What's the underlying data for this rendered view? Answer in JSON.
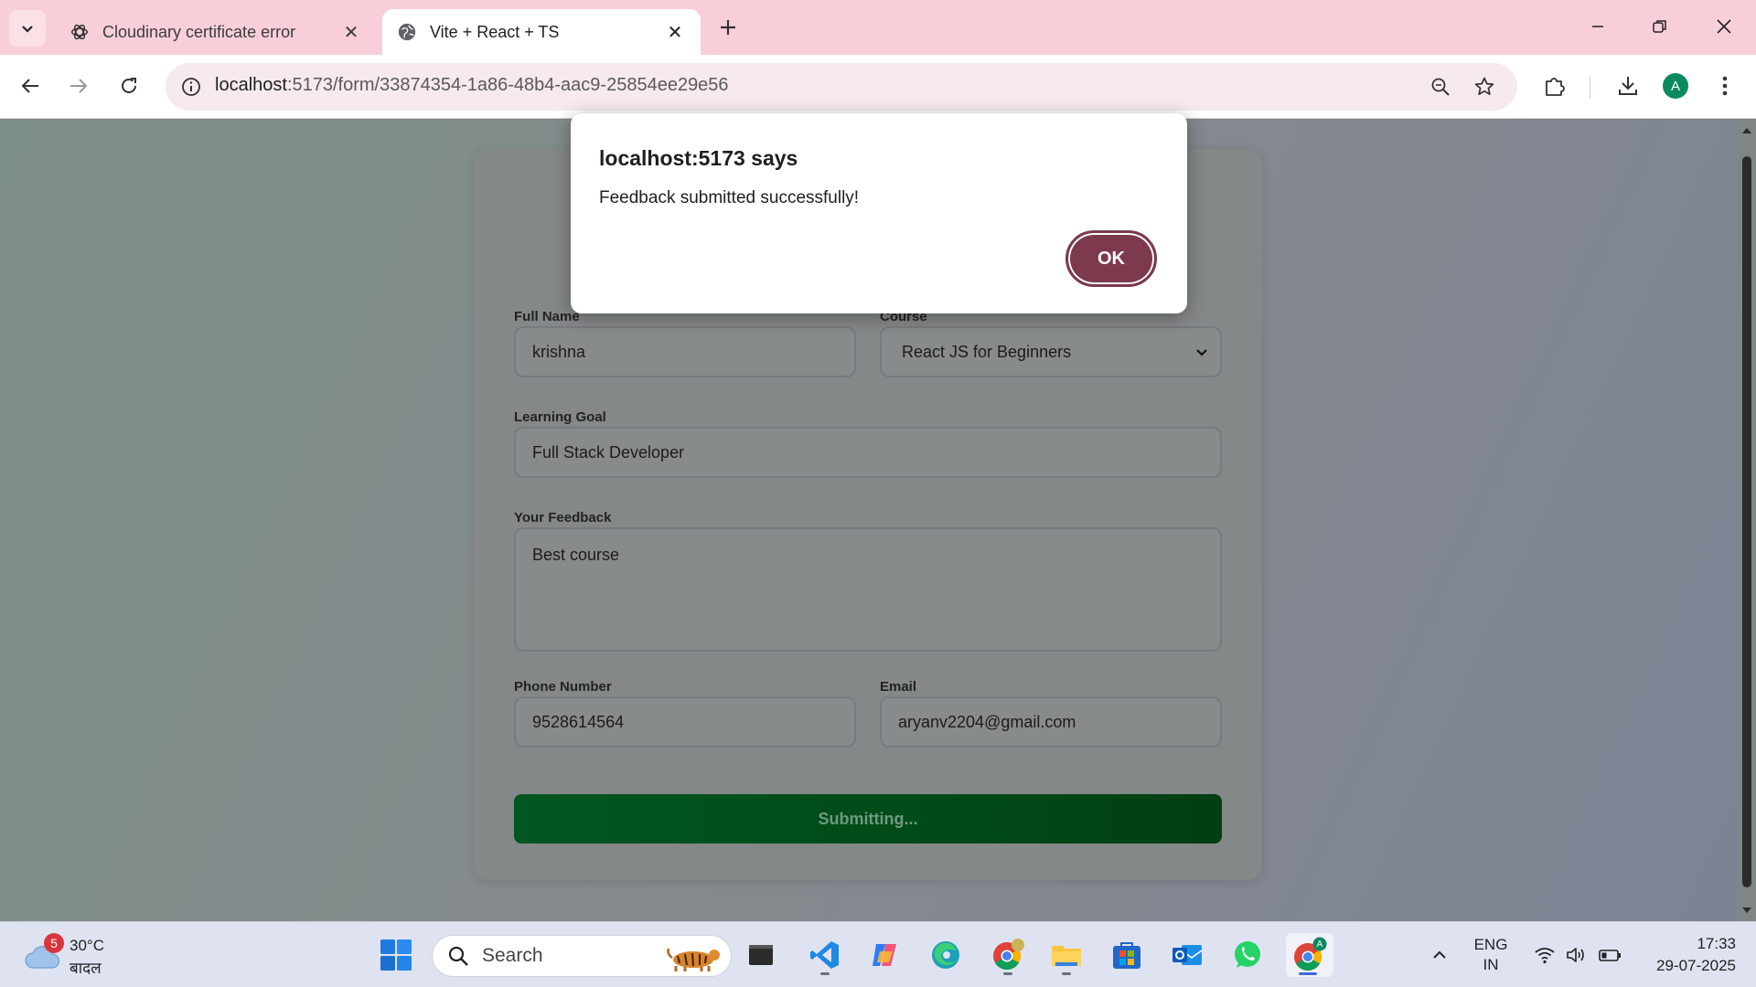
{
  "browser": {
    "tabs": [
      {
        "title": "Cloudinary certificate error",
        "active": false,
        "icon": "openai-icon"
      },
      {
        "title": "Vite + React + TS",
        "active": true,
        "icon": "globe-icon"
      }
    ],
    "url_host": "localhost",
    "url_path": ":5173/form/33874354-1a86-48b4-aac9-25854ee29e56",
    "profile_initial": "A"
  },
  "form": {
    "full_name": {
      "label": "Full Name",
      "value": "krishna"
    },
    "course": {
      "label": "Course",
      "value": "React JS for Beginners"
    },
    "learning_goal": {
      "label": "Learning Goal",
      "value": "Full Stack Developer"
    },
    "feedback": {
      "label": "Your Feedback",
      "value": "Best course"
    },
    "phone": {
      "label": "Phone Number",
      "value": "9528614564"
    },
    "email": {
      "label": "Email",
      "value": "aryanv2204@gmail.com"
    },
    "submit_label": "Submitting..."
  },
  "dialog": {
    "title": "localhost:5173 says",
    "message": "Feedback submitted successfully!",
    "ok_label": "OK"
  },
  "taskbar": {
    "weather": {
      "badge": "5",
      "temp": "30°C",
      "condition": "बादल"
    },
    "search_placeholder": "Search",
    "lang_line1": "ENG",
    "lang_line2": "IN",
    "time": "17:33",
    "date": "29-07-2025",
    "apps": [
      "file-explorer-dark",
      "vscode",
      "copilot",
      "edge",
      "chrome-canary",
      "file-explorer",
      "microsoft-store",
      "outlook",
      "whatsapp",
      "chrome"
    ]
  },
  "colors": {
    "tabstrip": "#f8cfd8",
    "dialog_ok": "#7c3a4c",
    "submit_button": "#00561f"
  }
}
